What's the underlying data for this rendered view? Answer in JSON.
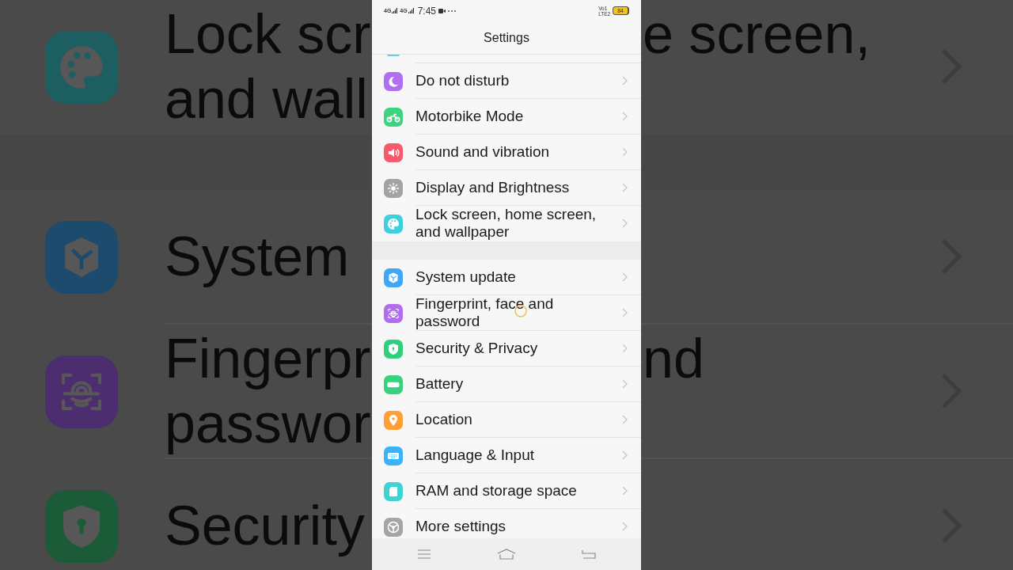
{
  "status_bar": {
    "networks": [
      "4G",
      "4G"
    ],
    "time": "7:45",
    "sim_labels": [
      "Vo1",
      "LTE2"
    ],
    "battery": "84"
  },
  "title": "Settings",
  "groups": [
    {
      "items": [
        {
          "label": "Do not disturb",
          "kind": "moon",
          "color": "#b06ef3"
        },
        {
          "label": "Motorbike Mode",
          "kind": "motorbike",
          "color": "#3ed47f"
        },
        {
          "label": "Sound and vibration",
          "kind": "speaker",
          "color": "#f85a6c"
        },
        {
          "label": "Display and Brightness",
          "kind": "sun",
          "color": "#a3a3a3"
        },
        {
          "label": "Lock screen, home screen, and wallpaper",
          "kind": "palette",
          "color": "#3fd0e0"
        }
      ]
    },
    {
      "items": [
        {
          "label": "System update",
          "kind": "cube",
          "color": "#3ea8f7"
        },
        {
          "label": "Fingerprint, face and password",
          "kind": "fingerprint",
          "color": "#b26cf0"
        },
        {
          "label": "Security & Privacy",
          "kind": "shield",
          "color": "#30cf7b"
        },
        {
          "label": "Battery",
          "kind": "battery",
          "color": "#38d27c"
        },
        {
          "label": "Location",
          "kind": "pin",
          "color": "#ff9f35"
        },
        {
          "label": "Language & Input",
          "kind": "keyboard",
          "color": "#3ab3f8"
        },
        {
          "label": "RAM and storage space",
          "kind": "sdcard",
          "color": "#40d3d6"
        },
        {
          "label": "More settings",
          "kind": "gear",
          "color": "#a5a5a5"
        }
      ]
    }
  ],
  "backdrop": {
    "groups": [
      {
        "rows": [
          {
            "kind": "palette",
            "color": "#1d5e61",
            "left": [
              "Lock scr",
              "and wall"
            ],
            "right": [
              "e screen,"
            ]
          }
        ]
      },
      {
        "rows": [
          {
            "kind": "cube",
            "color": "#1c4b6d",
            "left": [
              "System"
            ]
          },
          {
            "kind": "fingerprint",
            "color": "#4b2d70",
            "left": [
              "Fingerpr",
              "passwor"
            ],
            "right": [
              "nd"
            ]
          },
          {
            "kind": "shield",
            "color": "#1b5b37",
            "left": [
              "Security"
            ]
          }
        ]
      }
    ]
  }
}
